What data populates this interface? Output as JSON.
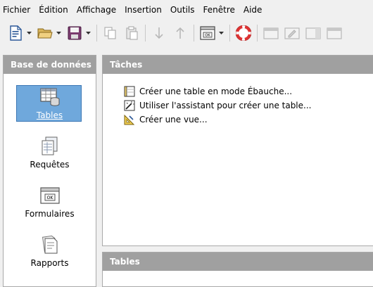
{
  "menu": [
    {
      "label": "Fichier"
    },
    {
      "label": "Édition"
    },
    {
      "label": "Affichage"
    },
    {
      "label": "Insertion"
    },
    {
      "label": "Outils"
    },
    {
      "label": "Fenêtre"
    },
    {
      "label": "Aide"
    }
  ],
  "left_panel": {
    "title": "Base de données",
    "items": [
      {
        "label": "Tables",
        "icon": "tables-icon",
        "selected": true
      },
      {
        "label": "Requêtes",
        "icon": "queries-icon",
        "selected": false
      },
      {
        "label": "Formulaires",
        "icon": "forms-icon",
        "selected": false
      },
      {
        "label": "Rapports",
        "icon": "reports-icon",
        "selected": false
      }
    ]
  },
  "tasks_panel": {
    "title": "Tâches",
    "tasks": [
      {
        "label": "Créer une table en mode Ébauche...",
        "icon": "design-table-icon"
      },
      {
        "label": "Utiliser l'assistant pour créer une table...",
        "icon": "wizard-icon"
      },
      {
        "label": "Créer une vue...",
        "icon": "create-view-icon"
      }
    ]
  },
  "tables_panel": {
    "title": "Tables"
  },
  "colors": {
    "panel_header": "#a0a0a0",
    "selection": "#6fa8dc",
    "selection_border": "#3d78b5",
    "background": "#f0f0f0"
  }
}
